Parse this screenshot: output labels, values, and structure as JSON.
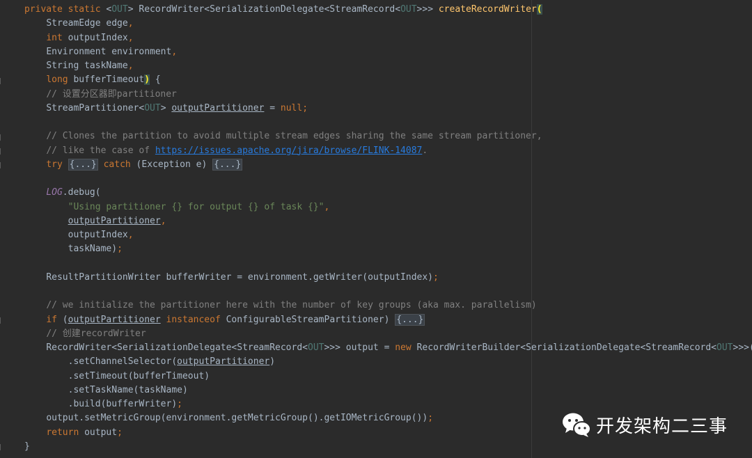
{
  "code": {
    "l1": {
      "a": "private static ",
      "b": "<",
      "c": "OUT",
      "d": "> RecordWriter<SerializationDelegate<StreamRecord<",
      "e": "OUT",
      "f": ">>> ",
      "g": "createRecordWriter",
      "h": "("
    },
    "l2": {
      "a": "StreamEdge edge",
      "b": ","
    },
    "l3": {
      "a": "int ",
      "b": "outputIndex",
      "c": ","
    },
    "l4": {
      "a": "Environment environment",
      "b": ","
    },
    "l5": {
      "a": "String taskName",
      "b": ","
    },
    "l6": {
      "a": "long ",
      "b": "bufferTimeout",
      "c": ")",
      "d": " {"
    },
    "l7": {
      "a": "// 设置分区器即partitioner"
    },
    "l8": {
      "a": "StreamPartitioner<",
      "b": "OUT",
      "c": "> ",
      "d": "outputPartitioner",
      "e": " = ",
      "f": "null;"
    },
    "l10": {
      "a": "// Clones the partition to avoid multiple stream edges sharing the same stream partitioner,"
    },
    "l11": {
      "a": "// like the case of ",
      "b": "https://issues.apache.org/jira/browse/FLINK-14087",
      "c": "."
    },
    "l12": {
      "a": "try ",
      "b": "{...}",
      "c": " catch",
      "d": " (Exception e) ",
      "e": "{...}"
    },
    "l14": {
      "a": "LOG",
      "b": ".debug("
    },
    "l15": {
      "a": "\"Using partitioner {} for output {} of task {}\"",
      "b": ","
    },
    "l16": {
      "a": "outputPartitioner",
      "b": ","
    },
    "l17": {
      "a": "outputIndex",
      "b": ","
    },
    "l18": {
      "a": "taskName)",
      "b": ";"
    },
    "l20": {
      "a": "ResultPartitionWriter bufferWriter = environment.getWriter(outputIndex)",
      "b": ";"
    },
    "l22": {
      "a": "// we initialize the partitioner here with the number of key groups (aka max. parallelism)"
    },
    "l23": {
      "a": "if ",
      "b": "(",
      "c": "outputPartitioner",
      "d": " instanceof",
      "e": " ConfigurableStreamPartitioner) ",
      "f": "{...}"
    },
    "l24": {
      "a": "// 创建recordWriter"
    },
    "l25": {
      "a": "RecordWriter<SerializationDelegate<StreamRecord<",
      "b": "OUT",
      "c": ">>> output = ",
      "d": "new",
      "e": " RecordWriterBuilder<SerializationDelegate<StreamRecord<",
      "f": "OUT",
      "g": ">>>()"
    },
    "l26": {
      "a": ".setChannelSelector(",
      "b": "outputPartitioner",
      "c": ")"
    },
    "l27": {
      "a": ".setTimeout(bufferTimeout)"
    },
    "l28": {
      "a": ".setTaskName(taskName)"
    },
    "l29": {
      "a": ".build(bufferWriter)",
      "b": ";"
    },
    "l30": {
      "a": "output.setMetricGroup(environment.getMetricGroup().getIOMetricGroup())",
      "b": ";"
    },
    "l31": {
      "a": "return ",
      "b": "output",
      "c": ";"
    },
    "l32": {
      "a": "}"
    }
  },
  "watermark": {
    "text": "开发架构二三事",
    "icon": "wechat-icon"
  }
}
